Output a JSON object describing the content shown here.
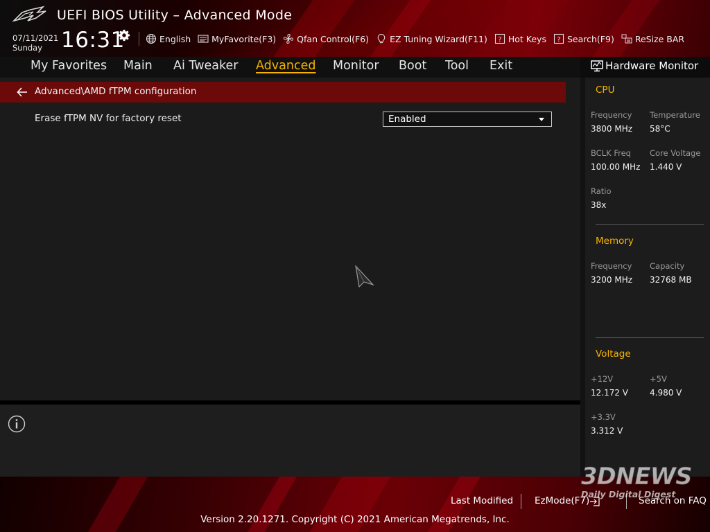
{
  "header": {
    "title": "UEFI BIOS Utility – Advanced Mode",
    "date": "07/11/2021",
    "day": "Sunday",
    "time": "16:31",
    "toolbar": {
      "language": "English",
      "favorite": "MyFavorite(F3)",
      "qfan": "Qfan Control(F6)",
      "ez_tuning": "EZ Tuning Wizard(F11)",
      "hot_keys": "Hot Keys",
      "search": "Search(F9)",
      "resize_bar": "ReSize BAR"
    }
  },
  "nav": {
    "tabs": [
      {
        "label": "My Favorites"
      },
      {
        "label": "Main"
      },
      {
        "label": "Ai Tweaker"
      },
      {
        "label": "Advanced"
      },
      {
        "label": "Monitor"
      },
      {
        "label": "Boot"
      },
      {
        "label": "Tool"
      },
      {
        "label": "Exit"
      }
    ],
    "active": "Advanced"
  },
  "main": {
    "breadcrumb": "Advanced\\AMD fTPM configuration",
    "settings": [
      {
        "label": "Erase fTPM NV for factory reset",
        "value": "Enabled"
      }
    ]
  },
  "hardware_monitor": {
    "title": "Hardware Monitor",
    "cpu": {
      "title": "CPU",
      "frequency_label": "Frequency",
      "frequency": "3800 MHz",
      "temperature_label": "Temperature",
      "temperature": "58°C",
      "bclk_label": "BCLK Freq",
      "bclk": "100.00 MHz",
      "core_voltage_label": "Core Voltage",
      "core_voltage": "1.440 V",
      "ratio_label": "Ratio",
      "ratio": "38x"
    },
    "memory": {
      "title": "Memory",
      "frequency_label": "Frequency",
      "frequency": "3200 MHz",
      "capacity_label": "Capacity",
      "capacity": "32768 MB"
    },
    "voltage": {
      "title": "Voltage",
      "v12_label": "+12V",
      "v12": "12.172 V",
      "v5_label": "+5V",
      "v5": "4.980 V",
      "v33_label": "+3.3V",
      "v33": "3.312 V"
    }
  },
  "footer": {
    "last_modified": "Last Modified",
    "ez_mode": "EzMode(F7)",
    "search_faq": "Search on FAQ",
    "copyright": "Version 2.20.1271. Copyright (C) 2021 American Megatrends, Inc."
  },
  "watermark": {
    "main": "3DNEWS",
    "sub": "Daily Digital Digest"
  },
  "colors": {
    "accent": "#f6b300",
    "breadcrumb_bar": "#6c0a0a",
    "header_red": "#7a0008"
  }
}
